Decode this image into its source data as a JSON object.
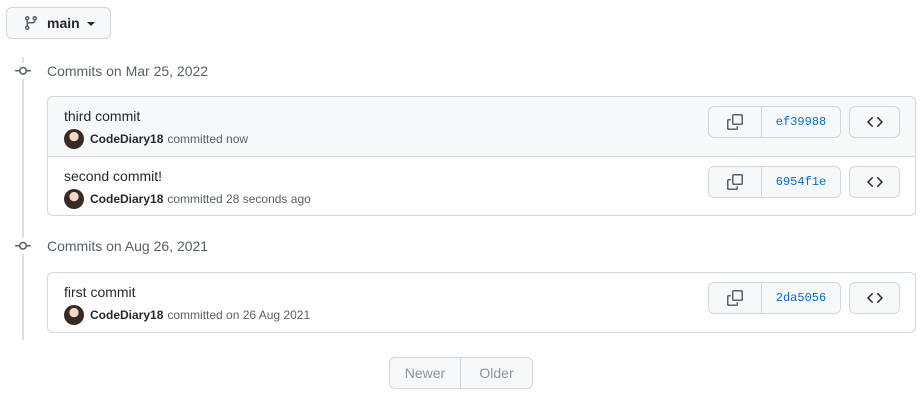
{
  "branch": {
    "name": "main",
    "icon": "git-branch-icon"
  },
  "groups": [
    {
      "title": "Commits on Mar 25, 2022",
      "commits": [
        {
          "message": "third commit",
          "author": "CodeDiary18",
          "time": "committed now",
          "sha": "ef39988"
        },
        {
          "message": "second commit!",
          "author": "CodeDiary18",
          "time": "committed 28 seconds ago",
          "sha": "6954f1e"
        }
      ]
    },
    {
      "title": "Commits on Aug 26, 2021",
      "commits": [
        {
          "message": "first commit",
          "author": "CodeDiary18",
          "time": "committed on 26 Aug 2021",
          "sha": "2da5056"
        }
      ]
    }
  ],
  "pagination": {
    "newer": "Newer",
    "older": "Older"
  },
  "colors": {
    "link": "#0969da",
    "border": "#d0d7de",
    "muted": "#57606a",
    "disabled": "#8c959f"
  }
}
